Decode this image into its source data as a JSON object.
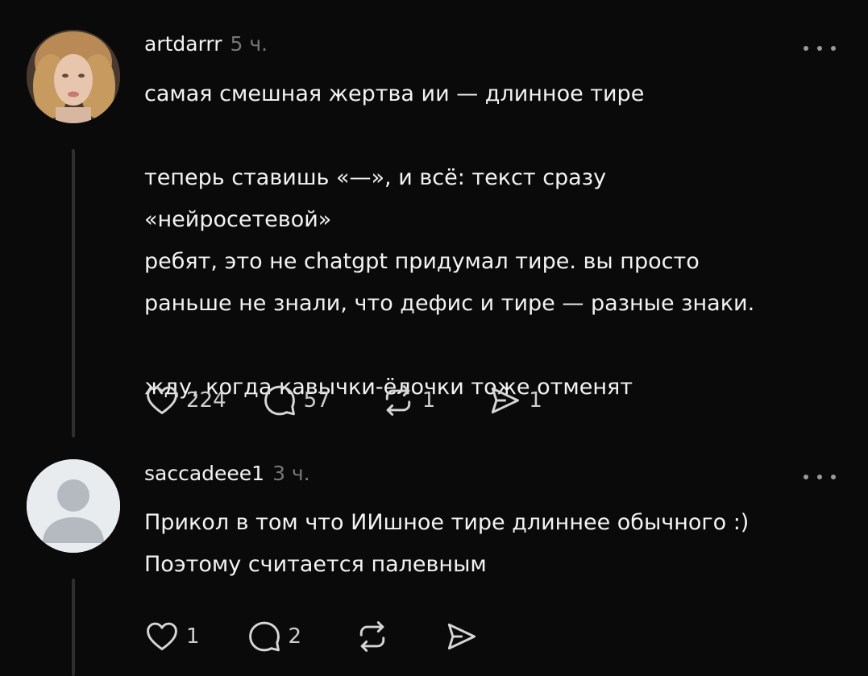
{
  "posts": [
    {
      "username": "artdarrr",
      "time": "5 ч.",
      "text_lines": [
        "самая смешная жертва ии — длинное тире",
        "",
        "теперь ставишь «—», и всё: текст сразу",
        "«нейросетевой»",
        "ребят, это не chatgpt придумал тире. вы просто",
        "раньше не знали, что дефис и тире — разные знаки.",
        "",
        "жду, когда кавычки-ёлочки тоже отменят"
      ],
      "likes": "224",
      "replies": "57",
      "reposts": "1",
      "shares": "1"
    },
    {
      "username": "saccadeee1",
      "time": "3 ч.",
      "text_lines": [
        "Прикол в том что ИИшное тире длиннее обычного :)",
        "Поэтому считается палевным"
      ],
      "likes": "1",
      "replies": "2"
    }
  ],
  "icons": {
    "like": "heart-icon",
    "reply": "comment-icon",
    "repost": "repost-icon",
    "share": "share-icon",
    "more": "more-icon"
  }
}
